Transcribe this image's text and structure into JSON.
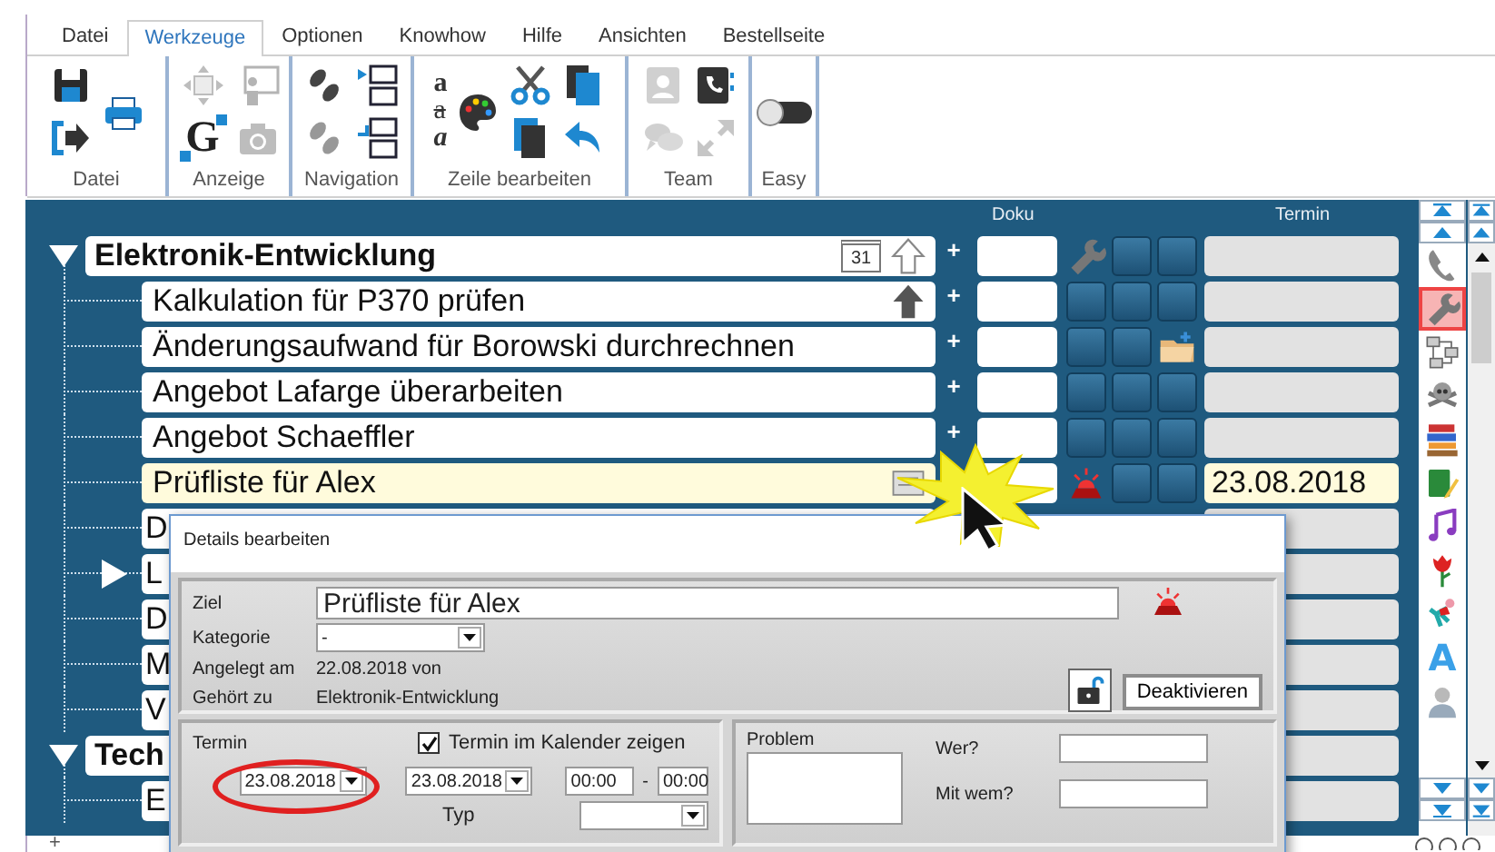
{
  "ribbon": {
    "tabs": [
      {
        "label": "Datei",
        "selected": false
      },
      {
        "label": "Werkzeuge",
        "selected": true
      },
      {
        "label": "Optionen",
        "selected": false
      },
      {
        "label": "Knowhow",
        "selected": false
      },
      {
        "label": "Hilfe",
        "selected": false
      },
      {
        "label": "Ansichten",
        "selected": false
      },
      {
        "label": "Bestellseite",
        "selected": false
      }
    ],
    "groups": [
      {
        "label": "Datei",
        "items": [
          {
            "kind": "save",
            "disabled": false
          },
          {
            "kind": "exit",
            "disabled": false
          },
          {
            "kind": "print",
            "disabled": false
          }
        ]
      },
      {
        "label": "Anzeige",
        "items": [
          {
            "kind": "move",
            "disabled": true
          },
          {
            "kind": "g-arrows",
            "text": "G",
            "disabled": false
          },
          {
            "kind": "presenter",
            "disabled": true
          },
          {
            "kind": "camera",
            "disabled": true
          }
        ]
      },
      {
        "label": "Navigation",
        "items": [
          {
            "kind": "footprints",
            "disabled": false
          },
          {
            "kind": "footprints",
            "disabled": true
          },
          {
            "kind": "layout-top",
            "disabled": false
          },
          {
            "kind": "layout-bottom",
            "disabled": false
          }
        ]
      },
      {
        "label": "Zeile bearbeiten",
        "items": [
          {
            "kind": "letters",
            "letters": [
              "a",
              "a",
              "a"
            ],
            "disabled": false
          },
          {
            "kind": "palette",
            "disabled": false
          },
          {
            "kind": "scissors",
            "disabled": false
          },
          {
            "kind": "copy",
            "disabled": false
          },
          {
            "kind": "clipboard",
            "disabled": false
          },
          {
            "kind": "undo",
            "disabled": false
          }
        ]
      },
      {
        "label": "Team",
        "items": [
          {
            "kind": "contacts",
            "disabled": true
          },
          {
            "kind": "chat",
            "disabled": true
          },
          {
            "kind": "phonebook",
            "disabled": false
          },
          {
            "kind": "expand",
            "disabled": true
          }
        ]
      },
      {
        "label": "Easy",
        "items": [
          {
            "kind": "toggle",
            "on": false
          }
        ]
      }
    ]
  },
  "tree": {
    "columns": [
      "Doku",
      "Termin"
    ],
    "groups": [
      {
        "title": "Elektronik-Entwicklung",
        "expanded": true,
        "badges": [
          {
            "kind": "calendar",
            "text": "31"
          },
          {
            "kind": "arrow-outline"
          }
        ],
        "add": "+",
        "marks": [
          {
            "kind": "wrench"
          },
          {
            "kind": "plain"
          },
          {
            "kind": "plain"
          }
        ],
        "children": [
          {
            "label": "Kalkulation für P370 prüfen",
            "selected": false,
            "current": false,
            "badges": [
              {
                "kind": "arrow"
              }
            ],
            "add": "+",
            "marks": [
              {
                "kind": "plain"
              },
              {
                "kind": "plain"
              },
              {
                "kind": "plain"
              }
            ]
          },
          {
            "label": "Änderungsaufwand für Borowski durchrechnen",
            "selected": false,
            "current": false,
            "add": "+",
            "marks": [
              {
                "kind": "plain"
              },
              {
                "kind": "plain"
              },
              {
                "kind": "folder"
              }
            ]
          },
          {
            "label": "Angebot Lafarge überarbeiten",
            "selected": false,
            "current": false,
            "add": "+",
            "marks": [
              {
                "kind": "plain"
              },
              {
                "kind": "plain"
              },
              {
                "kind": "plain"
              }
            ]
          },
          {
            "label": "Angebot Schaeffler",
            "selected": false,
            "current": false,
            "add": "+",
            "marks": [
              {
                "kind": "plain"
              },
              {
                "kind": "plain"
              },
              {
                "kind": "plain"
              }
            ]
          },
          {
            "label": "Prüfliste für Alex",
            "selected": true,
            "current": false,
            "badges": [
              {
                "kind": "note"
              }
            ],
            "marks": [
              {
                "kind": "alarm"
              },
              {
                "kind": "plain"
              },
              {
                "kind": "plain"
              }
            ],
            "termin": "23.08.2018"
          },
          {
            "label": "D",
            "selected": false,
            "current": false
          },
          {
            "label": "L",
            "selected": false,
            "current": true
          },
          {
            "label": "D",
            "selected": false,
            "current": false
          },
          {
            "label": "M",
            "selected": false,
            "current": false
          },
          {
            "label": "V",
            "selected": false,
            "current": false
          }
        ]
      },
      {
        "title": "Tech",
        "expanded": true,
        "children": [
          {
            "label": "E",
            "selected": false,
            "current": false
          }
        ]
      }
    ]
  },
  "sidebar": {
    "items": [
      {
        "kind": "phone",
        "selected": false
      },
      {
        "kind": "wrench",
        "selected": true
      },
      {
        "kind": "network",
        "selected": false
      },
      {
        "kind": "skull",
        "selected": false
      },
      {
        "kind": "books",
        "selected": false
      },
      {
        "kind": "notebook",
        "selected": false
      },
      {
        "kind": "music",
        "selected": false
      },
      {
        "kind": "rose",
        "selected": false
      },
      {
        "kind": "figure",
        "selected": false
      },
      {
        "kind": "letter",
        "text": "A",
        "selected": false
      },
      {
        "kind": "person",
        "selected": false
      }
    ]
  },
  "dialog": {
    "title": "Details bearbeiten",
    "ziel_label": "Ziel",
    "ziel": "Prüfliste für Alex",
    "kategorie_label": "Kategorie",
    "kategorie": "-",
    "angelegt_label": "Angelegt am",
    "angelegt": "22.08.2018 von",
    "gehoert_label": "Gehört zu",
    "gehoert": "Elektronik-Entwicklung",
    "locked": false,
    "deactivate_button": "Deaktivieren",
    "termin": {
      "label": "Termin",
      "date": "23.08.2018",
      "highlighted": true,
      "calendar_label": "Termin im Kalender zeigen",
      "calendar_checked": true,
      "calendar_date": "23.08.2018",
      "time_from": "00:00",
      "time_separator": "-",
      "time_to": "00:00",
      "typ_label": "Typ"
    },
    "problem": {
      "label": "Problem",
      "fields": [
        {
          "label": "Wer?"
        },
        {
          "label": "Mit wem?"
        }
      ]
    }
  },
  "status_bar": {
    "add": "+"
  }
}
